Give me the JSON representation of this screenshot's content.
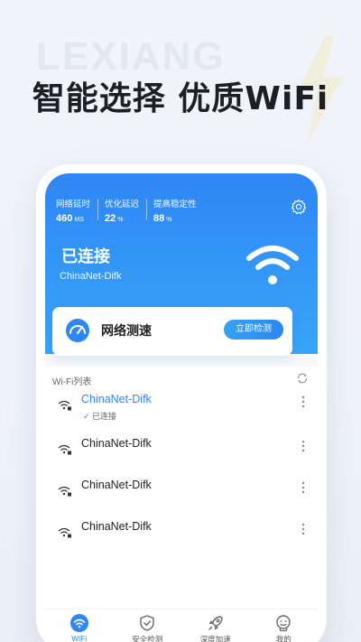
{
  "watermark": "LEXIANG",
  "headline": "智能选择 优质WiFi",
  "stats": [
    {
      "label": "网络延时",
      "value": "460",
      "unit": "MS"
    },
    {
      "label": "优化延迟",
      "value": "22",
      "unit": "%"
    },
    {
      "label": "提高稳定性",
      "value": "88",
      "unit": "%"
    }
  ],
  "connection": {
    "title": "已连接",
    "ssid": "ChinaNet-Difk"
  },
  "speed_test": {
    "label": "网络测速",
    "button": "立即检测"
  },
  "wifi_list": {
    "header": "Wi-Fi列表",
    "items": [
      {
        "name": "ChinaNet-Difk",
        "status": "已连接"
      },
      {
        "name": "ChinaNet-Difk"
      },
      {
        "name": "ChinaNet-Difk"
      },
      {
        "name": "ChinaNet-Difk"
      }
    ]
  },
  "tabs": [
    {
      "label": "WiFi",
      "icon": "wifi-icon"
    },
    {
      "label": "安全检测",
      "icon": "shield-icon"
    },
    {
      "label": "深度加速",
      "icon": "rocket-icon"
    },
    {
      "label": "我的",
      "icon": "profile-icon"
    }
  ],
  "colors": {
    "accent": "#2f86f5",
    "accent_light": "#37a6f7"
  }
}
